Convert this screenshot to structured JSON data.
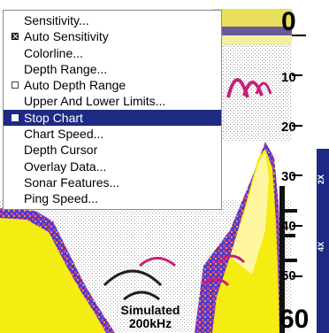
{
  "menu": {
    "items": [
      {
        "label": "Sensitivity...",
        "mark": "none",
        "selected": false
      },
      {
        "label": "Auto Sensitivity",
        "mark": "checked",
        "selected": false
      },
      {
        "label": "Colorline...",
        "mark": "none",
        "selected": false
      },
      {
        "label": "Depth Range...",
        "mark": "none",
        "selected": false
      },
      {
        "label": "Auto Depth Range",
        "mark": "unchecked",
        "selected": false
      },
      {
        "label": "Upper And Lower Limits...",
        "mark": "none",
        "selected": false
      },
      {
        "label": "Stop Chart",
        "mark": "square",
        "selected": true
      },
      {
        "label": "Chart Speed...",
        "mark": "none",
        "selected": false
      },
      {
        "label": "Depth Cursor",
        "mark": "none",
        "selected": false
      },
      {
        "label": "Overlay Data...",
        "mark": "none",
        "selected": false
      },
      {
        "label": "Sonar Features...",
        "mark": "none",
        "selected": false
      },
      {
        "label": "Ping Speed...",
        "mark": "none",
        "selected": false
      }
    ]
  },
  "depth_scale": {
    "top": "0",
    "marks": [
      "10",
      "20",
      "30",
      "40",
      "50"
    ],
    "bottom": "60"
  },
  "zoom": {
    "labels": [
      "2X",
      "4X"
    ]
  },
  "simulation": {
    "line1": "Simulated",
    "line2": "200kHz"
  },
  "colors": {
    "menu_selected": "#1e2a84",
    "zoom_bar": "#1e2a84",
    "bottom_yellow": "#f5ec12",
    "fish_arch": "#c8207a"
  }
}
